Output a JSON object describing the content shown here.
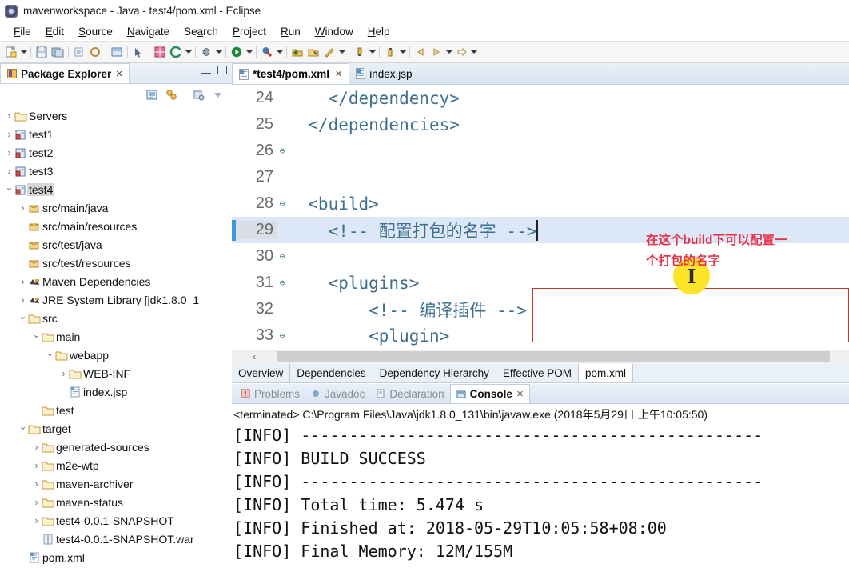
{
  "window": {
    "title": "mavenworkspace - Java - test4/pom.xml - Eclipse",
    "app_icon": "eclipse-icon"
  },
  "menubar": [
    {
      "label": "File"
    },
    {
      "label": "Edit"
    },
    {
      "label": "Source"
    },
    {
      "label": "Navigate"
    },
    {
      "label": "Search"
    },
    {
      "label": "Project"
    },
    {
      "label": "Run"
    },
    {
      "label": "Window"
    },
    {
      "label": "Help"
    }
  ],
  "explorer": {
    "tab_label": "Package Explorer",
    "close_glyph": "✕",
    "minimize_label": "minimize-view",
    "maximize_label": "maximize-view",
    "toolbar": [
      "collapse-all-icon",
      "link-with-editor-icon",
      "view-menu-icon",
      "view-chevron-icon"
    ],
    "tree": [
      {
        "label": "Servers",
        "indent": 0,
        "arrow": "closed",
        "icon": "folder-icon",
        "selected": false
      },
      {
        "label": "test1",
        "indent": 0,
        "arrow": "closed",
        "icon": "project-icon",
        "selected": false
      },
      {
        "label": "test2",
        "indent": 0,
        "arrow": "closed",
        "icon": "project-icon",
        "selected": false
      },
      {
        "label": "test3",
        "indent": 0,
        "arrow": "closed",
        "icon": "project-icon",
        "selected": false
      },
      {
        "label": "test4",
        "indent": 0,
        "arrow": "open",
        "icon": "project-icon",
        "selected": true
      },
      {
        "label": "src/main/java",
        "indent": 1,
        "arrow": "closed",
        "icon": "package-icon",
        "selected": false
      },
      {
        "label": "src/main/resources",
        "indent": 1,
        "arrow": "none",
        "icon": "package-icon",
        "selected": false
      },
      {
        "label": "src/test/java",
        "indent": 1,
        "arrow": "none",
        "icon": "package-icon",
        "selected": false
      },
      {
        "label": "src/test/resources",
        "indent": 1,
        "arrow": "none",
        "icon": "package-icon",
        "selected": false
      },
      {
        "label": "Maven Dependencies",
        "indent": 1,
        "arrow": "closed",
        "icon": "library-icon",
        "selected": false
      },
      {
        "label": "JRE System Library [jdk1.8.0_1",
        "indent": 1,
        "arrow": "closed",
        "icon": "library-icon",
        "selected": false
      },
      {
        "label": "src",
        "indent": 1,
        "arrow": "open",
        "icon": "folder-icon",
        "selected": false
      },
      {
        "label": "main",
        "indent": 2,
        "arrow": "open",
        "icon": "folder-icon",
        "selected": false
      },
      {
        "label": "webapp",
        "indent": 3,
        "arrow": "open",
        "icon": "folder-icon",
        "selected": false
      },
      {
        "label": "WEB-INF",
        "indent": 4,
        "arrow": "closed",
        "icon": "folder-icon",
        "selected": false
      },
      {
        "label": "index.jsp",
        "indent": 4,
        "arrow": "none",
        "icon": "file-icon",
        "selected": false
      },
      {
        "label": "test",
        "indent": 2,
        "arrow": "none",
        "icon": "folder-icon",
        "selected": false
      },
      {
        "label": "target",
        "indent": 1,
        "arrow": "open",
        "icon": "folder-icon",
        "selected": false
      },
      {
        "label": "generated-sources",
        "indent": 2,
        "arrow": "closed",
        "icon": "folder-icon",
        "selected": false
      },
      {
        "label": "m2e-wtp",
        "indent": 2,
        "arrow": "closed",
        "icon": "folder-icon",
        "selected": false
      },
      {
        "label": "maven-archiver",
        "indent": 2,
        "arrow": "closed",
        "icon": "folder-icon",
        "selected": false
      },
      {
        "label": "maven-status",
        "indent": 2,
        "arrow": "closed",
        "icon": "folder-icon",
        "selected": false
      },
      {
        "label": "test4-0.0.1-SNAPSHOT",
        "indent": 2,
        "arrow": "closed",
        "icon": "folder-icon",
        "selected": false
      },
      {
        "label": "test4-0.0.1-SNAPSHOT.war",
        "indent": 2,
        "arrow": "none",
        "icon": "archive-icon",
        "selected": false
      },
      {
        "label": "pom.xml",
        "indent": 1,
        "arrow": "none",
        "icon": "xml-file-icon",
        "selected": false
      }
    ]
  },
  "editor": {
    "tabs": [
      {
        "label": "*test4/pom.xml",
        "active": true,
        "icon": "xml-file-icon",
        "close_glyph": "✕"
      },
      {
        "label": "index.jsp",
        "active": false,
        "icon": "jsp-file-icon",
        "close_glyph": ""
      }
    ],
    "lines": [
      {
        "num": "24",
        "fold": false,
        "highlight": false,
        "text": "    </dependency>"
      },
      {
        "num": "25",
        "fold": false,
        "highlight": false,
        "text": "  </dependencies>"
      },
      {
        "num": "26",
        "fold": true,
        "highlight": false,
        "text": ""
      },
      {
        "num": "27",
        "fold": false,
        "highlight": false,
        "text": ""
      },
      {
        "num": "28",
        "fold": true,
        "highlight": false,
        "text": "  <build>"
      },
      {
        "num": "29",
        "fold": false,
        "highlight": true,
        "text": "    <!-- 配置打包的名字 -->"
      },
      {
        "num": "30",
        "fold": true,
        "highlight": false,
        "text": ""
      },
      {
        "num": "31",
        "fold": true,
        "highlight": false,
        "text": "    <plugins>"
      },
      {
        "num": "32",
        "fold": false,
        "highlight": false,
        "text": "        <!-- 编译插件 -->"
      },
      {
        "num": "33",
        "fold": true,
        "highlight": false,
        "text": "        <plugin>"
      }
    ],
    "annotation_line1": "在这个build下可以配置一",
    "annotation_line2": "个打包的名字",
    "annotation_color": "#e8314a",
    "redbox_color": "#c0392b",
    "cursor_marker": "text-cursor-highlight",
    "scroll_left_glyph": "‹",
    "pom_tabs": [
      {
        "label": "Overview",
        "active": false
      },
      {
        "label": "Dependencies",
        "active": false
      },
      {
        "label": "Dependency Hierarchy",
        "active": false
      },
      {
        "label": "Effective POM",
        "active": false
      },
      {
        "label": "pom.xml",
        "active": true
      }
    ]
  },
  "console": {
    "tabs": [
      {
        "label": "Problems",
        "active": false,
        "icon": "problems-icon",
        "close_glyph": ""
      },
      {
        "label": "Javadoc",
        "active": false,
        "icon": "javadoc-icon",
        "close_glyph": ""
      },
      {
        "label": "Declaration",
        "active": false,
        "icon": "declaration-icon",
        "close_glyph": ""
      },
      {
        "label": "Console",
        "active": true,
        "icon": "console-icon",
        "close_glyph": "✕"
      }
    ],
    "terminated_line": "<terminated> C:\\Program Files\\Java\\jdk1.8.0_131\\bin\\javaw.exe (2018年5月29日 上午10:05:50)",
    "output": [
      "[INFO] ------------------------------------------------",
      "[INFO] BUILD SUCCESS",
      "[INFO] ------------------------------------------------",
      "[INFO] Total time: 5.474 s",
      "[INFO] Finished at: 2018-05-29T10:05:58+08:00",
      "[INFO] Final Memory: 12M/155M"
    ]
  }
}
